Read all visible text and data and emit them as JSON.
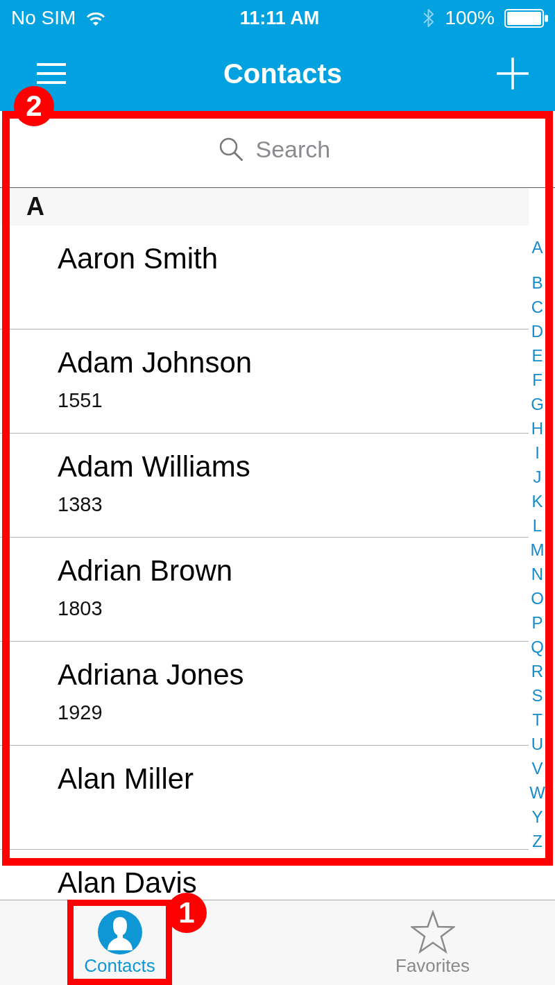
{
  "status_bar": {
    "carrier": "No SIM",
    "time": "11:11 AM",
    "battery": "100%"
  },
  "nav_bar": {
    "title": "Contacts"
  },
  "contact_list": {
    "callout": "2",
    "search": {
      "placeholder": "Search"
    },
    "sections": [
      {
        "title": "A",
        "contacts": [
          {
            "name": "Aaron Smith"
          },
          {
            "name": "Adam Johnson",
            "number": "1551"
          },
          {
            "name": "Adam Williams",
            "number": "1383"
          },
          {
            "name": "Adrian Brown",
            "number": "1803"
          },
          {
            "name": "Adriana Jones",
            "number": "1929"
          },
          {
            "name": "Alan Miller"
          },
          {
            "name": "Alan Davis"
          }
        ]
      }
    ],
    "index": [
      "A",
      "B",
      "C",
      "D",
      "E",
      "F",
      "G",
      "H",
      "I",
      "J",
      "K",
      "L",
      "M",
      "N",
      "O",
      "P",
      "Q",
      "R",
      "S",
      "T",
      "U",
      "V",
      "W",
      "Y",
      "Z"
    ]
  },
  "tab_bar": {
    "tabs": [
      {
        "kind": "contacts",
        "label": "Contacts",
        "selected": true,
        "callout": "1"
      },
      {
        "kind": "favorites",
        "label": "Favorites",
        "selected": false
      }
    ]
  }
}
